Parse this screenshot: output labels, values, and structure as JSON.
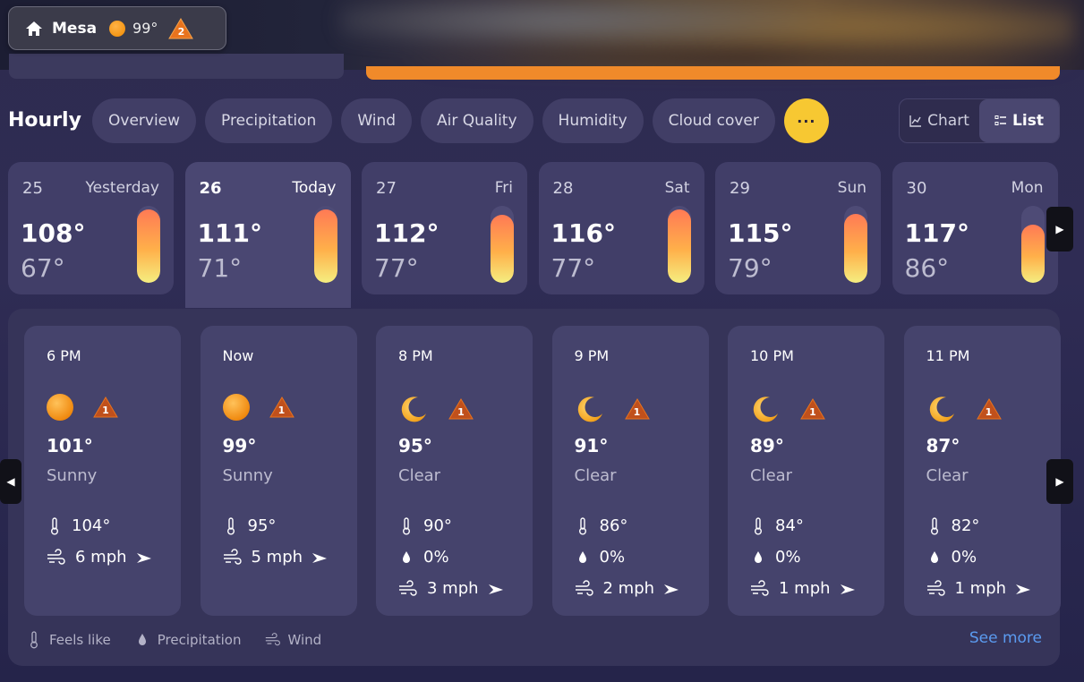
{
  "location": {
    "city": "Mesa",
    "temp": "99°",
    "alerts": "2"
  },
  "hourly_title": "Hourly",
  "tabs": [
    "Overview",
    "Precipitation",
    "Wind",
    "Air Quality",
    "Humidity",
    "Cloud cover"
  ],
  "more_label": "···",
  "view": {
    "chart_label": "Chart",
    "list_label": "List",
    "active": "List"
  },
  "days": [
    {
      "num": "25",
      "label": "Yesterday",
      "hi": "108°",
      "lo": "67°",
      "range": [
        0.05,
        1.0
      ]
    },
    {
      "num": "26",
      "label": "Today",
      "hi": "111°",
      "lo": "71°",
      "range": [
        0.05,
        1.0
      ]
    },
    {
      "num": "27",
      "label": "Fri",
      "hi": "112°",
      "lo": "77°",
      "range": [
        0.12,
        1.0
      ]
    },
    {
      "num": "28",
      "label": "Sat",
      "hi": "116°",
      "lo": "77°",
      "range": [
        0.05,
        1.0
      ]
    },
    {
      "num": "29",
      "label": "Sun",
      "hi": "115°",
      "lo": "79°",
      "range": [
        0.1,
        1.0
      ]
    },
    {
      "num": "30",
      "label": "Mon",
      "hi": "117°",
      "lo": "86°",
      "range": [
        0.24,
        1.0
      ]
    }
  ],
  "hours": [
    {
      "time": "6 PM",
      "icon": "sun-icon",
      "alert": "1",
      "temp": "101°",
      "cond": "Sunny",
      "feels": "104°",
      "precip": "",
      "wind": "6 mph"
    },
    {
      "time": "Now",
      "icon": "sun-icon",
      "alert": "1",
      "temp": "99°",
      "cond": "Sunny",
      "feels": "95°",
      "precip": "",
      "wind": "5 mph"
    },
    {
      "time": "8 PM",
      "icon": "moon-icon",
      "alert": "1",
      "temp": "95°",
      "cond": "Clear",
      "feels": "90°",
      "precip": "0%",
      "wind": "3 mph"
    },
    {
      "time": "9 PM",
      "icon": "moon-icon",
      "alert": "1",
      "temp": "91°",
      "cond": "Clear",
      "feels": "86°",
      "precip": "0%",
      "wind": "2 mph"
    },
    {
      "time": "10 PM",
      "icon": "moon-icon",
      "alert": "1",
      "temp": "89°",
      "cond": "Clear",
      "feels": "84°",
      "precip": "0%",
      "wind": "1 mph"
    },
    {
      "time": "11 PM",
      "icon": "moon-icon",
      "alert": "1",
      "temp": "87°",
      "cond": "Clear",
      "feels": "82°",
      "precip": "0%",
      "wind": "1 mph"
    }
  ],
  "legend": {
    "feels": "Feels like",
    "precip": "Precipitation",
    "wind": "Wind"
  },
  "see_more": "See more",
  "colors": {
    "accent": "#f7c832",
    "link": "#5b9bf0",
    "alert": "#e8731e"
  }
}
